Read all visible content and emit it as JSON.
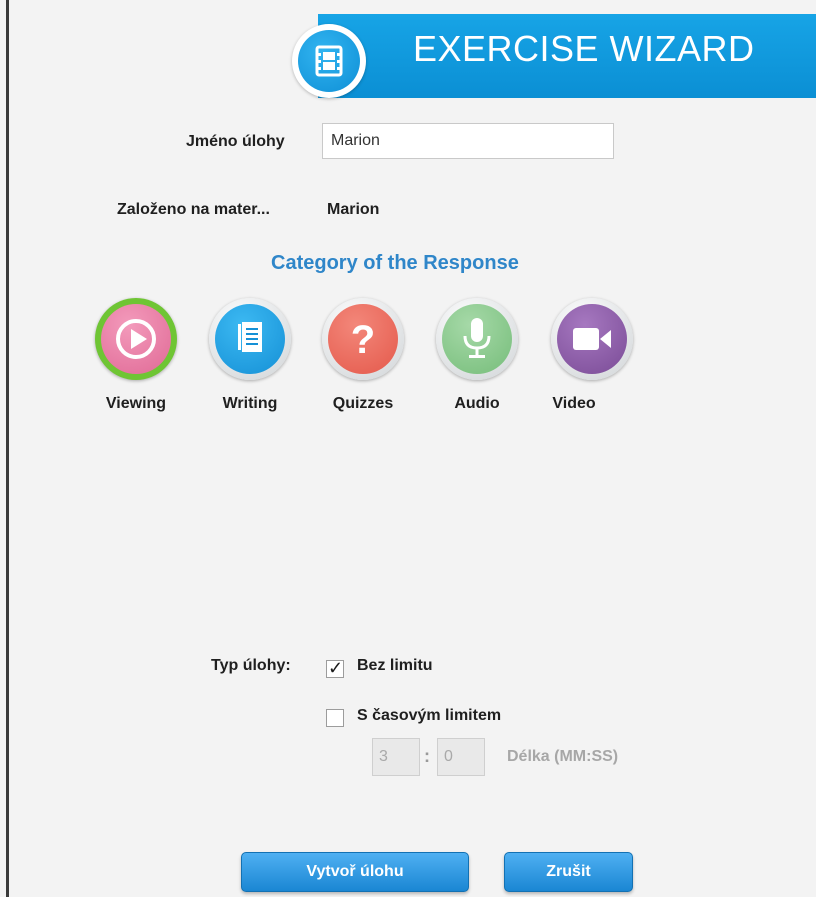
{
  "header": {
    "title": "EXERCISE WIZARD",
    "icon": "film-icon"
  },
  "form": {
    "task_name_label": "Jméno úlohy",
    "task_name_value": "Marion",
    "based_on_label": "Založeno na mater...",
    "based_on_value": "Marion"
  },
  "category": {
    "title": "Category of the Response",
    "items": [
      {
        "label": "Viewing",
        "icon": "play-icon",
        "color": "#e8739e",
        "selected": true
      },
      {
        "label": "Writing",
        "icon": "document-icon",
        "color": "#1e9ee0",
        "selected": false
      },
      {
        "label": "Quizzes",
        "icon": "question-icon",
        "color": "#ec6d5d",
        "selected": false
      },
      {
        "label": "Audio",
        "icon": "microphone-icon",
        "color": "#89c98c",
        "selected": false
      },
      {
        "label": "Video",
        "icon": "camera-icon",
        "color": "#8a5aa4",
        "selected": false
      }
    ]
  },
  "task_type": {
    "label": "Typ úlohy:",
    "no_limit_label": "Bez limitu",
    "no_limit_checked": true,
    "time_limit_label": "S časovým limitem",
    "time_limit_checked": false,
    "minutes": "3",
    "seconds": "0",
    "separator": ":",
    "duration_label": "Délka (MM:SS)"
  },
  "buttons": {
    "create": "Vytvoř úlohu",
    "cancel": "Zrušit"
  },
  "colors": {
    "accent": "#0b8fd4",
    "section_title": "#2f86c9",
    "selected_ring": "#6fc534"
  }
}
